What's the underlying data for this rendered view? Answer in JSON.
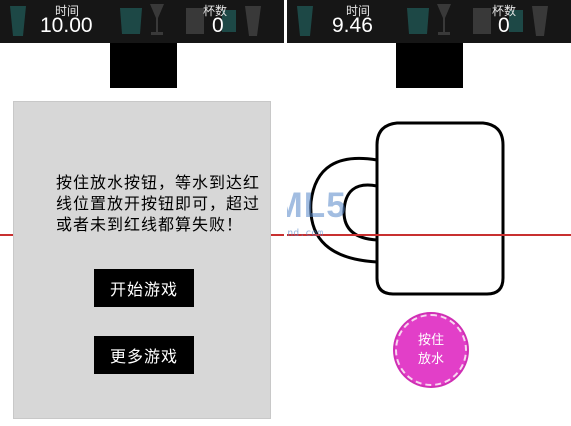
{
  "left_screen": {
    "time_label": "时间",
    "time_value": "10.00",
    "cups_label": "杯数",
    "cups_value": "0",
    "instructions": "按住放水按钮，等水到达红线位置放开按钮即可，超过或者未到红线都算失败！",
    "start_button": "开始游戏",
    "more_button": "更多游戏"
  },
  "right_screen": {
    "time_label": "时间",
    "time_value": "9.46",
    "cups_label": "杯数",
    "cups_value": "0",
    "pour_button_line1": "按住",
    "pour_button_line2": "放水"
  },
  "watermark": {
    "title": "HTML5",
    "subtitle": "bbs.zzfriend.com"
  },
  "colors": {
    "topbar": "#161616",
    "overlay": "#d7d7d7",
    "red_line": "#c83030",
    "pour_button": "#e23fc8",
    "watermark": "#5587c8"
  },
  "icons": [
    "drinkware-decor-icons",
    "water-tap",
    "mug-outline"
  ]
}
